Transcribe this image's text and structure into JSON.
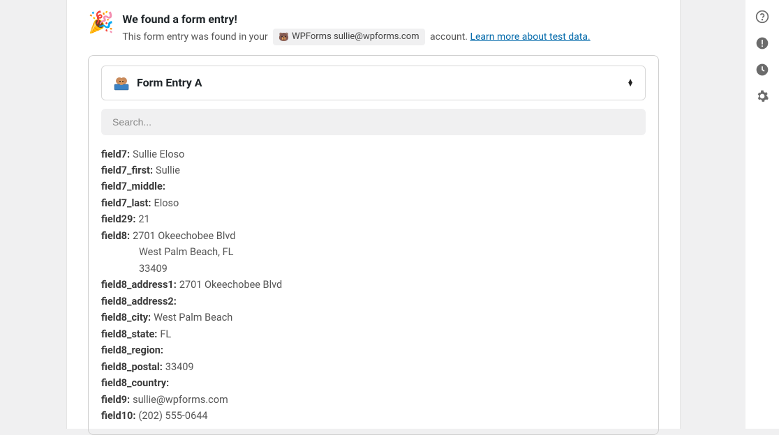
{
  "header": {
    "title": "We found a form entry!",
    "subtitle_prefix": "This form entry was found in your ",
    "account_label": "WPForms sullie@wpforms.com",
    "subtitle_suffix": " account. ",
    "learn_more": "Learn more about test data."
  },
  "selector": {
    "title": "Form Entry A"
  },
  "search": {
    "placeholder": "Search..."
  },
  "fields": [
    {
      "label": "field7:",
      "value": "Sullie Eloso"
    },
    {
      "label": "field7_first:",
      "value": "Sullie"
    },
    {
      "label": "field7_middle:",
      "value": ""
    },
    {
      "label": "field7_last:",
      "value": "Eloso"
    },
    {
      "label": "field29:",
      "value": "21"
    },
    {
      "label": "field8:",
      "value": "2701 Okeechobee Blvd"
    },
    {
      "label": "",
      "value": "West Palm Beach, FL",
      "indent": true
    },
    {
      "label": "",
      "value": "33409",
      "indent": true
    },
    {
      "label": "field8_address1:",
      "value": "2701 Okeechobee Blvd"
    },
    {
      "label": "field8_address2:",
      "value": ""
    },
    {
      "label": "field8_city:",
      "value": "West Palm Beach"
    },
    {
      "label": "field8_state:",
      "value": "FL"
    },
    {
      "label": "field8_region:",
      "value": ""
    },
    {
      "label": "field8_postal:",
      "value": "33409"
    },
    {
      "label": "field8_country:",
      "value": ""
    },
    {
      "label": "field9:",
      "value": "sullie@wpforms.com"
    },
    {
      "label": "field10:",
      "value": "(202) 555-0644"
    }
  ]
}
